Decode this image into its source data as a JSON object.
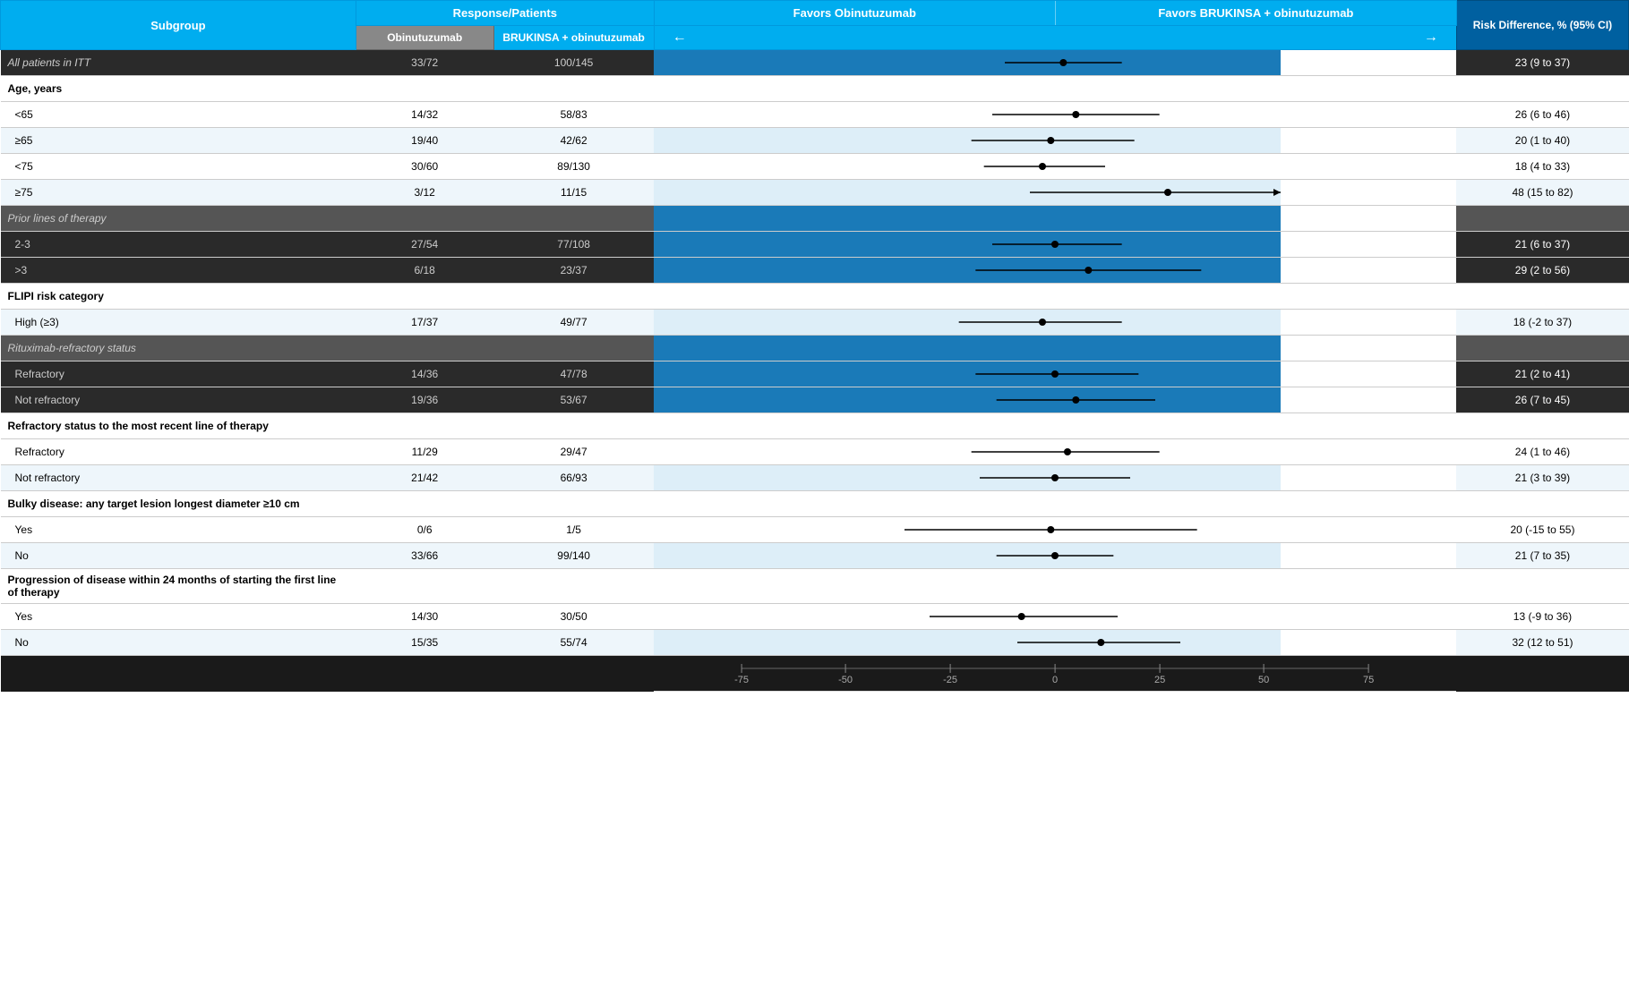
{
  "header": {
    "subgroup_label": "Subgroup",
    "response_patients_label": "Response/Patients",
    "obinutuzumab_label": "Obinutuzumab",
    "brukinsa_label": "BRUKINSA + obinutuzumab",
    "favors_obi_label": "Favors Obinutuzumab",
    "favors_bru_label": "Favors BRUKINSA + obinutuzumab",
    "risk_diff_label": "Risk Difference, % (95% CI)"
  },
  "rows": [
    {
      "id": "iit",
      "type": "dark-section-data",
      "subgroup": "All patients in ITT",
      "obi": "33/72",
      "bru": "100/145",
      "risk": "23 (9 to 37)",
      "forest": {
        "center": 0.62,
        "low": 0.55,
        "high": 0.69,
        "area": "right"
      }
    },
    {
      "id": "age-header",
      "type": "bold-header",
      "subgroup": "Age, years",
      "obi": "",
      "bru": "",
      "risk": ""
    },
    {
      "id": "age-lt65",
      "type": "white",
      "subgroup": "<65",
      "obi": "14/32",
      "bru": "58/83",
      "risk": "26 (6 to 46)",
      "forest": {
        "center": 0.63,
        "low": 0.56,
        "high": 0.7,
        "area": "right"
      }
    },
    {
      "id": "age-gte65",
      "type": "light",
      "subgroup": "≥65",
      "obi": "19/40",
      "bru": "42/62",
      "risk": "20 (1 to 40)",
      "forest": {
        "center": 0.62,
        "low": 0.56,
        "high": 0.68,
        "area": "right"
      }
    },
    {
      "id": "age-lt75",
      "type": "white",
      "subgroup": "<75",
      "obi": "30/60",
      "bru": "89/130",
      "risk": "18 (4 to 33)",
      "forest": {
        "center": 0.61,
        "low": 0.55,
        "high": 0.67,
        "area": "right"
      }
    },
    {
      "id": "age-gte75",
      "type": "light",
      "subgroup": "≥75",
      "obi": "3/12",
      "bru": "11/15",
      "risk": "48 (15 to 82)",
      "forest": {
        "center": 0.8,
        "low": 0.73,
        "high": 0.99,
        "area": "right",
        "arrow": true
      }
    },
    {
      "id": "prior-header",
      "type": "dark-section-header",
      "subgroup": "Prior lines of therapy",
      "obi": "",
      "bru": "",
      "risk": ""
    },
    {
      "id": "prior-2-3",
      "type": "dark-data",
      "subgroup": "2-3",
      "obi": "27/54",
      "bru": "77/108",
      "risk": "21 (6 to 37)",
      "forest": {
        "center": 0.63,
        "low": 0.56,
        "high": 0.7,
        "area": "right"
      }
    },
    {
      "id": "prior-gt3",
      "type": "dark-data",
      "subgroup": ">3",
      "obi": "6/18",
      "bru": "23/37",
      "risk": "29 (2 to 56)",
      "forest": {
        "center": 0.65,
        "low": 0.54,
        "high": 0.76,
        "area": "right"
      }
    },
    {
      "id": "flipi-header",
      "type": "bold-header",
      "subgroup": "FLIPI risk category",
      "obi": "",
      "bru": "",
      "risk": ""
    },
    {
      "id": "flipi-high",
      "type": "light",
      "subgroup": "High (≥3)",
      "obi": "17/37",
      "bru": "49/77",
      "risk": "18 (-2 to 37)",
      "forest": {
        "center": 0.6,
        "low": 0.53,
        "high": 0.67,
        "area": "right"
      }
    },
    {
      "id": "ritux-header",
      "type": "dark-section-header",
      "subgroup": "Rituximab-refractory status",
      "obi": "",
      "bru": "",
      "risk": ""
    },
    {
      "id": "ritux-ref",
      "type": "dark-data",
      "subgroup": "Refractory",
      "obi": "14/36",
      "bru": "47/78",
      "risk": "21 (2 to 41)",
      "forest": {
        "center": 0.62,
        "low": 0.55,
        "high": 0.7,
        "area": "right"
      }
    },
    {
      "id": "ritux-not",
      "type": "dark-data",
      "subgroup": "Not refractory",
      "obi": "19/36",
      "bru": "53/67",
      "risk": "26 (7 to 45)",
      "forest": {
        "center": 0.64,
        "low": 0.57,
        "high": 0.71,
        "area": "right"
      }
    },
    {
      "id": "refrac-header",
      "type": "bold-header",
      "subgroup": "Refractory status to the most recent line of therapy",
      "obi": "",
      "bru": "",
      "risk": ""
    },
    {
      "id": "refrac-yes",
      "type": "white",
      "subgroup": "Refractory",
      "obi": "11/29",
      "bru": "29/47",
      "risk": "24 (1 to 46)",
      "forest": {
        "center": 0.62,
        "low": 0.55,
        "high": 0.69,
        "area": "right"
      }
    },
    {
      "id": "refrac-no",
      "type": "light",
      "subgroup": "Not refractory",
      "obi": "21/42",
      "bru": "66/93",
      "risk": "21 (3 to 39)",
      "forest": {
        "center": 0.62,
        "low": 0.56,
        "high": 0.68,
        "area": "right"
      }
    },
    {
      "id": "bulky-header",
      "type": "bold-header-multi",
      "subgroup": "Bulky disease: any target lesion longest diameter ≥10 cm",
      "obi": "",
      "bru": "",
      "risk": ""
    },
    {
      "id": "bulky-yes",
      "type": "white",
      "subgroup": "Yes",
      "obi": "0/6",
      "bru": "1/5",
      "risk": "20 (-15 to 55)",
      "forest": {
        "center": 0.52,
        "low": 0.35,
        "high": 0.7,
        "area": "right"
      }
    },
    {
      "id": "bulky-no",
      "type": "light",
      "subgroup": "No",
      "obi": "33/66",
      "bru": "99/140",
      "risk": "21 (7 to 35)",
      "forest": {
        "center": 0.62,
        "low": 0.56,
        "high": 0.68,
        "area": "right"
      }
    },
    {
      "id": "pod24-header",
      "type": "bold-header-multi",
      "subgroup": "Progression of disease within 24 months of starting the first line of therapy",
      "obi": "",
      "bru": "",
      "risk": ""
    },
    {
      "id": "pod24-yes",
      "type": "white",
      "subgroup": "Yes",
      "obi": "14/30",
      "bru": "30/50",
      "risk": "13 (-9 to 36)",
      "forest": {
        "center": 0.53,
        "low": 0.45,
        "high": 0.62,
        "area": "right"
      }
    },
    {
      "id": "pod24-no",
      "type": "light",
      "subgroup": "No",
      "obi": "15/35",
      "bru": "55/74",
      "risk": "32 (12 to 51)",
      "forest": {
        "center": 0.66,
        "low": 0.59,
        "high": 0.73,
        "area": "right"
      }
    }
  ],
  "axis": {
    "labels": [
      "-75",
      "-50",
      "-25",
      "0",
      "25",
      "50",
      "75"
    ]
  },
  "colors": {
    "header_blue": "#00adef",
    "dark_blue_header": "#0060a0",
    "dark_row_bg": "#333333",
    "section_row_bg": "#555555",
    "forest_blue_bg": "#1a7ab8",
    "forest_light_bg": "#ddeef8",
    "white": "#ffffff",
    "light_gray": "#f0f7fa"
  }
}
